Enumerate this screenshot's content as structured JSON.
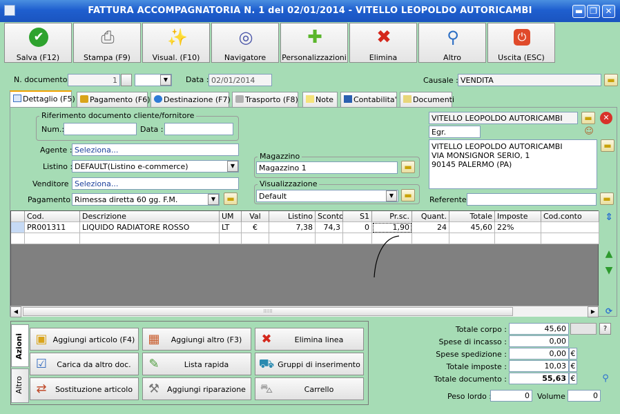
{
  "window": {
    "title": "FATTURA ACCOMPAGNATORIA N. 1 del 02/01/2014 - VITELLO LEOPOLDO AUTORICAMBI",
    "min": "▬",
    "max": "❐",
    "close": "✕"
  },
  "toolbar": [
    {
      "name": "save",
      "label": "Salva (F12)",
      "icon": "check-icon",
      "glyph": "✔",
      "color": "#2ea32e"
    },
    {
      "name": "print",
      "label": "Stampa (F9)",
      "icon": "printer-icon",
      "glyph": "⎙",
      "color": "#666666"
    },
    {
      "name": "visual",
      "label": "Visual. (F10)",
      "icon": "magic-wand-icon",
      "glyph": "✨",
      "color": "#c79a1a"
    },
    {
      "name": "navigator",
      "label": "Navigatore",
      "icon": "compass-icon",
      "glyph": "◎",
      "color": "#4a55a8"
    },
    {
      "name": "custom",
      "label": "Personalizzazioni",
      "icon": "puzzle-icon",
      "glyph": "✚",
      "color": "#5bb62c"
    },
    {
      "name": "delete",
      "label": "Elimina",
      "icon": "red-x-icon",
      "glyph": "✖",
      "color": "#d4281c"
    },
    {
      "name": "other",
      "label": "Altro",
      "icon": "magnifier-icon",
      "glyph": "⚲",
      "color": "#2d6fc4"
    },
    {
      "name": "exit",
      "label": "Uscita (ESC)",
      "icon": "power-icon",
      "glyph": "⏻",
      "color": "#e04a2a"
    }
  ],
  "doc": {
    "number_label": "N. documento :",
    "number": "1",
    "date_label": "Data :",
    "date": "02/01/2014",
    "causale_label": "Causale :",
    "causale": "VENDITA"
  },
  "tabs": [
    {
      "label": "Dettaglio (F5)",
      "icon": "detail-icon",
      "active": true
    },
    {
      "label": "Pagamento (F6)",
      "icon": "payment-icon"
    },
    {
      "label": "Destinazione (F7)",
      "icon": "globe-icon"
    },
    {
      "label": "Trasporto (F8)",
      "icon": "truck-icon"
    },
    {
      "label": "Note",
      "icon": "note-icon"
    },
    {
      "label": "Contabilita'",
      "icon": "book-icon"
    },
    {
      "label": "Documenti",
      "icon": "folder-icon"
    }
  ],
  "rif": {
    "title": "Riferimento documento cliente/fornitore",
    "num_label": "Num.:",
    "num": "",
    "data_label": "Data :",
    "data": ""
  },
  "agente": {
    "label": "Agente :",
    "value": "Seleziona..."
  },
  "listino": {
    "label": "Listino :",
    "value": "DEFAULT(Listino e-commerce)"
  },
  "venditore": {
    "label": "Venditore :",
    "value": "Seleziona..."
  },
  "pagamento": {
    "label": "Pagamento :",
    "value": "Rimessa diretta 60 gg. F.M."
  },
  "magazzino": {
    "title": "Magazzino",
    "value": "Magazzino 1"
  },
  "visualizzazione": {
    "title": "Visualizzazione",
    "value": "Default"
  },
  "cliente": {
    "name": "VITELLO LEOPOLDO AUTORICAMBI",
    "salutation": "Egr.",
    "address": [
      "VITELLO LEOPOLDO AUTORICAMBI",
      "VIA MONSIGNOR SERIO, 1",
      "90145 PALERMO (PA)"
    ],
    "referente_label": "Referente",
    "referente": ""
  },
  "grid": {
    "columns": [
      "",
      "Cod.",
      "Descrizione",
      "UM",
      "Val",
      "Listino",
      "Sconto",
      "S1",
      "Pr.sc.",
      "Quant.",
      "Totale",
      "Imposte",
      "Cod.conto"
    ],
    "rows": [
      [
        "",
        "PR001311",
        "LIQUIDO RADIATORE ROSSO",
        "LT",
        "€",
        "7,38",
        "74,3",
        "0",
        "1,90",
        "24",
        "45,60",
        "22%",
        ""
      ]
    ]
  },
  "actions": {
    "tab_azioni": "Azioni",
    "tab_altro": "Altro",
    "buttons": [
      {
        "label": "Aggiungi articolo (F4)",
        "icon": "add-article-icon",
        "glyph": "▣",
        "color": "#d9a41a"
      },
      {
        "label": "Aggiungi altro (F3)",
        "icon": "add-other-icon",
        "glyph": "▦",
        "color": "#c85a2a"
      },
      {
        "label": "Elimina linea",
        "icon": "delete-line-icon",
        "glyph": "✖",
        "color": "#d4281c"
      },
      {
        "label": "Carica da altro doc.",
        "icon": "load-doc-icon",
        "glyph": "☑",
        "color": "#3a6fc0"
      },
      {
        "label": "Lista rapida",
        "icon": "quick-list-icon",
        "glyph": "✎",
        "color": "#4a9a3a"
      },
      {
        "label": "Gruppi di inserimento",
        "icon": "groups-icon",
        "glyph": "⛟",
        "color": "#2a8ab0"
      },
      {
        "label": "Sostituzione articolo",
        "icon": "replace-article-icon",
        "glyph": "⇄",
        "color": "#c04a2a"
      },
      {
        "label": "Aggiungi riparazione",
        "icon": "wrench-icon",
        "glyph": "⚒",
        "color": "#777777"
      },
      {
        "label": "Carrello",
        "icon": "cart-icon",
        "glyph": "⛍",
        "color": "#888888"
      }
    ]
  },
  "totals": {
    "corpo_label": "Totale corpo :",
    "corpo": "45,60",
    "help": "?",
    "incasso_label": "Spese di incasso :",
    "incasso": "0,00",
    "spedizione_label": "Spese spedizione :",
    "spedizione": "0,00",
    "imposte_label": "Totale imposte :",
    "imposte": "10,03",
    "documento_label": "Totale documento :",
    "documento": "55,63",
    "currency": "€",
    "peso_label": "Peso lordo :",
    "peso": "0",
    "volume_label": "Volume :",
    "volume": "0"
  }
}
